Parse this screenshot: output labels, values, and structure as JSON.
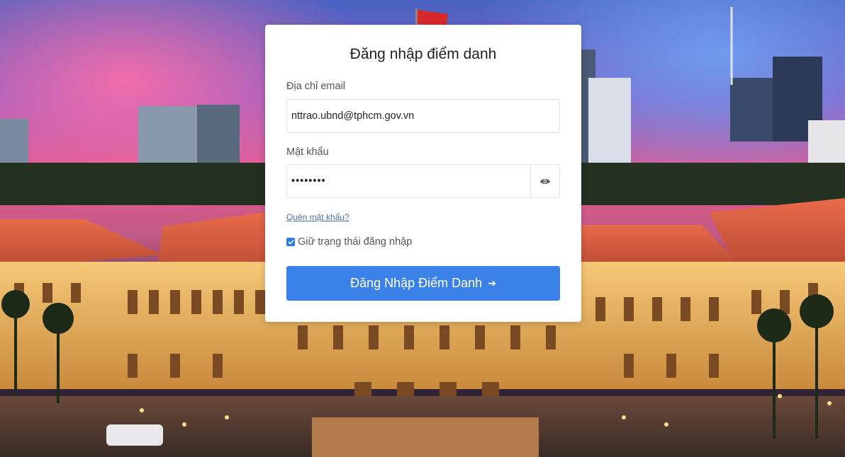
{
  "form": {
    "title": "Đăng nhập điểm danh",
    "email_label": "Địa chỉ email",
    "email_value": "nttrao.ubnd@tphcm.gov.vn",
    "password_label": "Mật khẩu",
    "password_value": "••••••••",
    "forgot_link": "Quên mật khẩu?",
    "remember_label": "Giữ trạng thái đăng nhập",
    "remember_checked": true,
    "submit_label": "Đăng Nhập Điểm Danh",
    "submit_icon": "arrow-right-icon",
    "password_toggle_icon": "eye-icon"
  },
  "colors": {
    "primary": "#3b82e8",
    "link": "#4a6fa5",
    "sky_top": "#3c5fb8",
    "sky_pink": "#e8508a",
    "building_lights": "#f4b55a"
  }
}
